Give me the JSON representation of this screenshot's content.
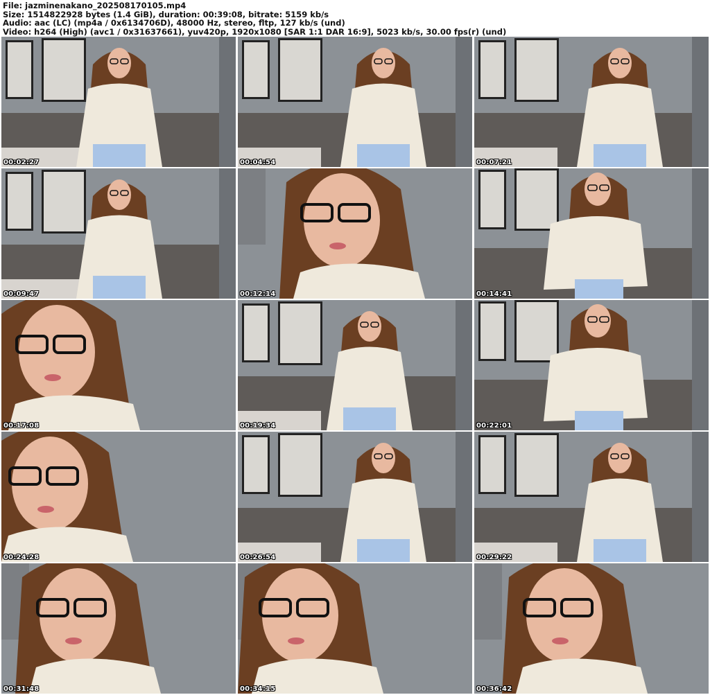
{
  "header": {
    "file_line": "File: jazminenakano_202508170105.mp4",
    "size_line": "Size: 1514822928 bytes (1.4 GiB), duration: 00:39:08, bitrate: 5159 kb/s",
    "audio_line": "Audio: aac (LC) (mp4a / 0x6134706D), 48000 Hz, stereo, fltp, 127 kb/s (und)",
    "video_line": "Video: h264 (High) (avc1 / 0x31637661), yuv420p, 1920x1080 [SAR 1:1 DAR 16:9], 5023 kb/s, 30.00 fps(r) (und)"
  },
  "thumbnails": [
    {
      "timestamp": "00:02:27",
      "shot": "wide"
    },
    {
      "timestamp": "00:04:54",
      "shot": "wide"
    },
    {
      "timestamp": "00:07:21",
      "shot": "wide"
    },
    {
      "timestamp": "00:09:47",
      "shot": "wide"
    },
    {
      "timestamp": "00:12:14",
      "shot": "close"
    },
    {
      "timestamp": "00:14:41",
      "shot": "medium"
    },
    {
      "timestamp": "00:17:08",
      "shot": "close"
    },
    {
      "timestamp": "00:19:34",
      "shot": "wide"
    },
    {
      "timestamp": "00:22:01",
      "shot": "medium"
    },
    {
      "timestamp": "00:24:28",
      "shot": "close"
    },
    {
      "timestamp": "00:26:54",
      "shot": "wide"
    },
    {
      "timestamp": "00:29:22",
      "shot": "wide"
    },
    {
      "timestamp": "00:31:48",
      "shot": "close"
    },
    {
      "timestamp": "00:34:15",
      "shot": "close"
    },
    {
      "timestamp": "00:36:42",
      "shot": "close"
    }
  ],
  "colors": {
    "wall": "#8c9196",
    "headboard": "#6e6a66",
    "sweater": "#efe9dc",
    "skirt": "#a9c4e6",
    "hair": "#6b3f22",
    "skin": "#e8b9a0",
    "frame_art": "#d9d7d2"
  }
}
